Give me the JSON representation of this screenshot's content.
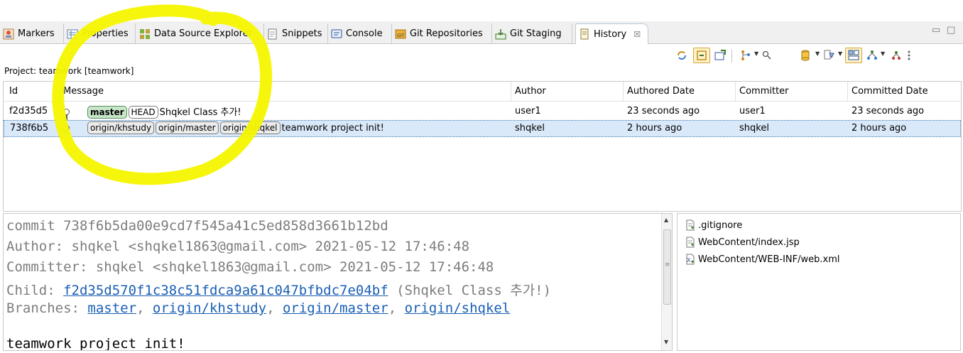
{
  "tabs": [
    {
      "label": "Markers",
      "icon": "markers-icon"
    },
    {
      "label": "Properties",
      "icon": "properties-icon"
    },
    {
      "label": "Data Source Explorer",
      "icon": "data-source-explorer-icon"
    },
    {
      "label": "Snippets",
      "icon": "snippets-icon"
    },
    {
      "label": "Console",
      "icon": "console-icon"
    },
    {
      "label": "Git Repositories",
      "icon": "git-repositories-icon"
    },
    {
      "label": "Git Staging",
      "icon": "git-staging-icon"
    },
    {
      "label": "History",
      "icon": "history-icon",
      "active": true,
      "close": "☒"
    }
  ],
  "window_controls": {
    "minimize": "▭",
    "maximize": "□"
  },
  "project_label": "Project: teamwork [teamwork]",
  "table": {
    "columns": [
      "Id",
      "Message",
      "Author",
      "Authored Date",
      "Committer",
      "Committed Date"
    ],
    "rows": [
      {
        "id": "f2d35d5",
        "refs": [
          {
            "label": "master",
            "kind": "branch"
          },
          {
            "label": "HEAD",
            "kind": "head"
          }
        ],
        "message": "Shqkel Class 추가!",
        "author": "user1",
        "authored_date": "23 seconds ago",
        "committer": "user1",
        "committed_date": "23 seconds ago",
        "selected": false
      },
      {
        "id": "738f6b5",
        "refs": [
          {
            "label": "origin/khstudy",
            "kind": "remote"
          },
          {
            "label": "origin/master",
            "kind": "remote"
          },
          {
            "label": "origin/shqkel",
            "kind": "remote"
          }
        ],
        "message": "teamwork project init!",
        "author": "shqkel",
        "authored_date": "2 hours ago",
        "committer": "shqkel",
        "committed_date": "2 hours ago",
        "selected": true
      }
    ]
  },
  "detail": {
    "commit_line": "commit 738f6b5da00e9cd7f545a41c5ed858d3661b12bd",
    "author_line": "Author: shqkel <shqkel1863@gmail.com> 2021-05-12 17:46:48",
    "committer_line": "Committer: shqkel <shqkel1863@gmail.com> 2021-05-12 17:46:48",
    "child_label": "Child: ",
    "child_hash": "f2d35d570f1c38c51fdca9a61c047bfbdc7e04bf",
    "child_suffix": " (Shqkel Class 추가!)",
    "branches_label": "Branches: ",
    "branches": [
      "master",
      "origin/khstudy",
      "origin/master",
      "origin/shqkel"
    ],
    "branch_sep": ", ",
    "message": "teamwork project init!"
  },
  "files": [
    {
      "name": ".gitignore",
      "icon": "text-file-icon"
    },
    {
      "name": "WebContent/index.jsp",
      "icon": "jsp-file-icon"
    },
    {
      "name": "WebContent/WEB-INF/web.xml",
      "icon": "xml-file-icon"
    }
  ],
  "colors": {
    "annotation": "#f5f500",
    "link": "#1a5fb4",
    "selection": "#d9e9f9",
    "branch_ref": "#c8e6c9"
  }
}
